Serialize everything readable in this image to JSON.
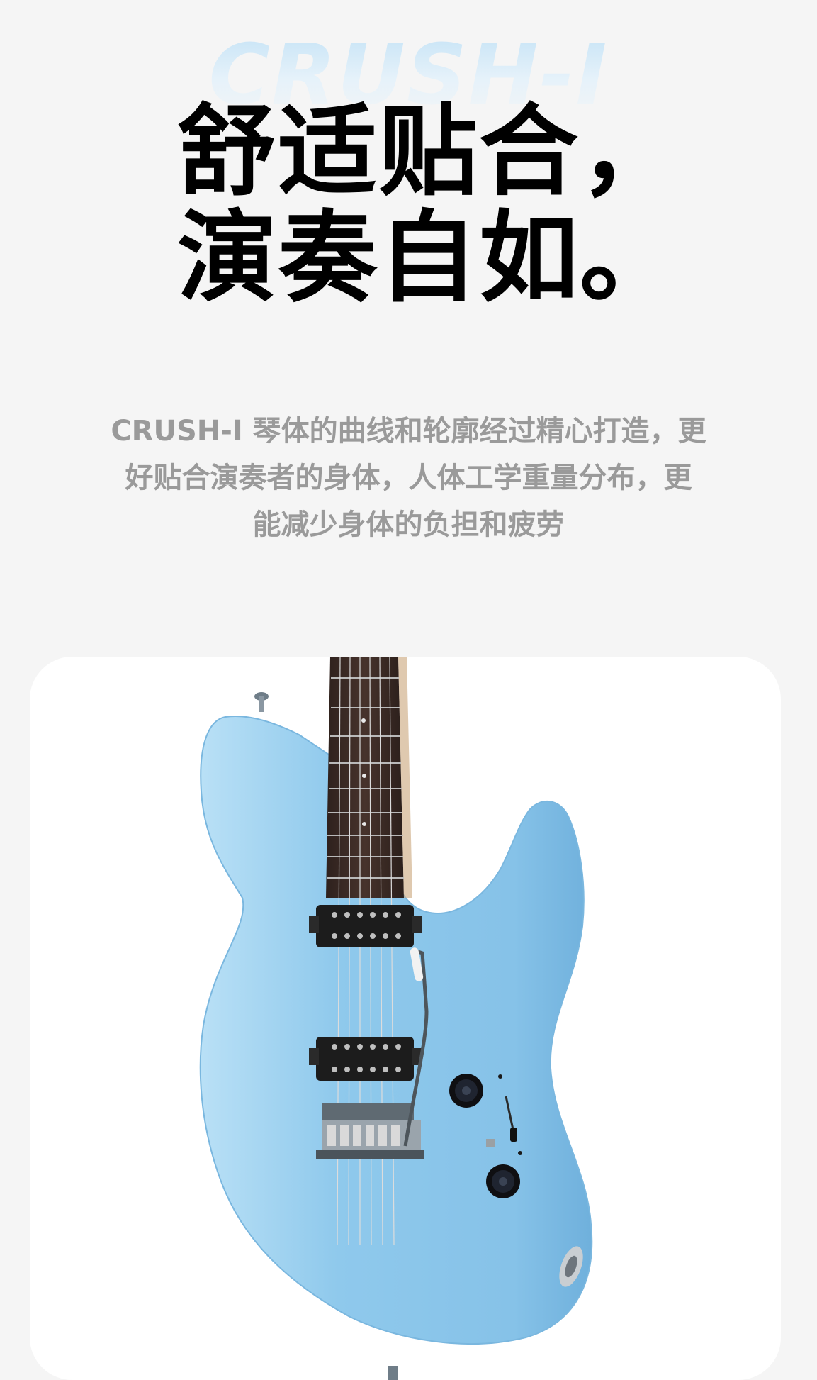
{
  "hero": {
    "watermark": "CRUSH-I",
    "headline_line1": "舒适贴合，",
    "headline_line2": "演奏自如。"
  },
  "description": {
    "line1": "CRUSH-I 琴体的曲线和轮廓经过精心打造，更",
    "line2": "好贴合演奏者的身体，人体工学重量分布，更",
    "line3": "能减少身体的负担和疲劳"
  },
  "product": {
    "image": "electric-guitar-image",
    "body_color": "#8fc9ec",
    "fretboard_color": "#3b2a25"
  }
}
